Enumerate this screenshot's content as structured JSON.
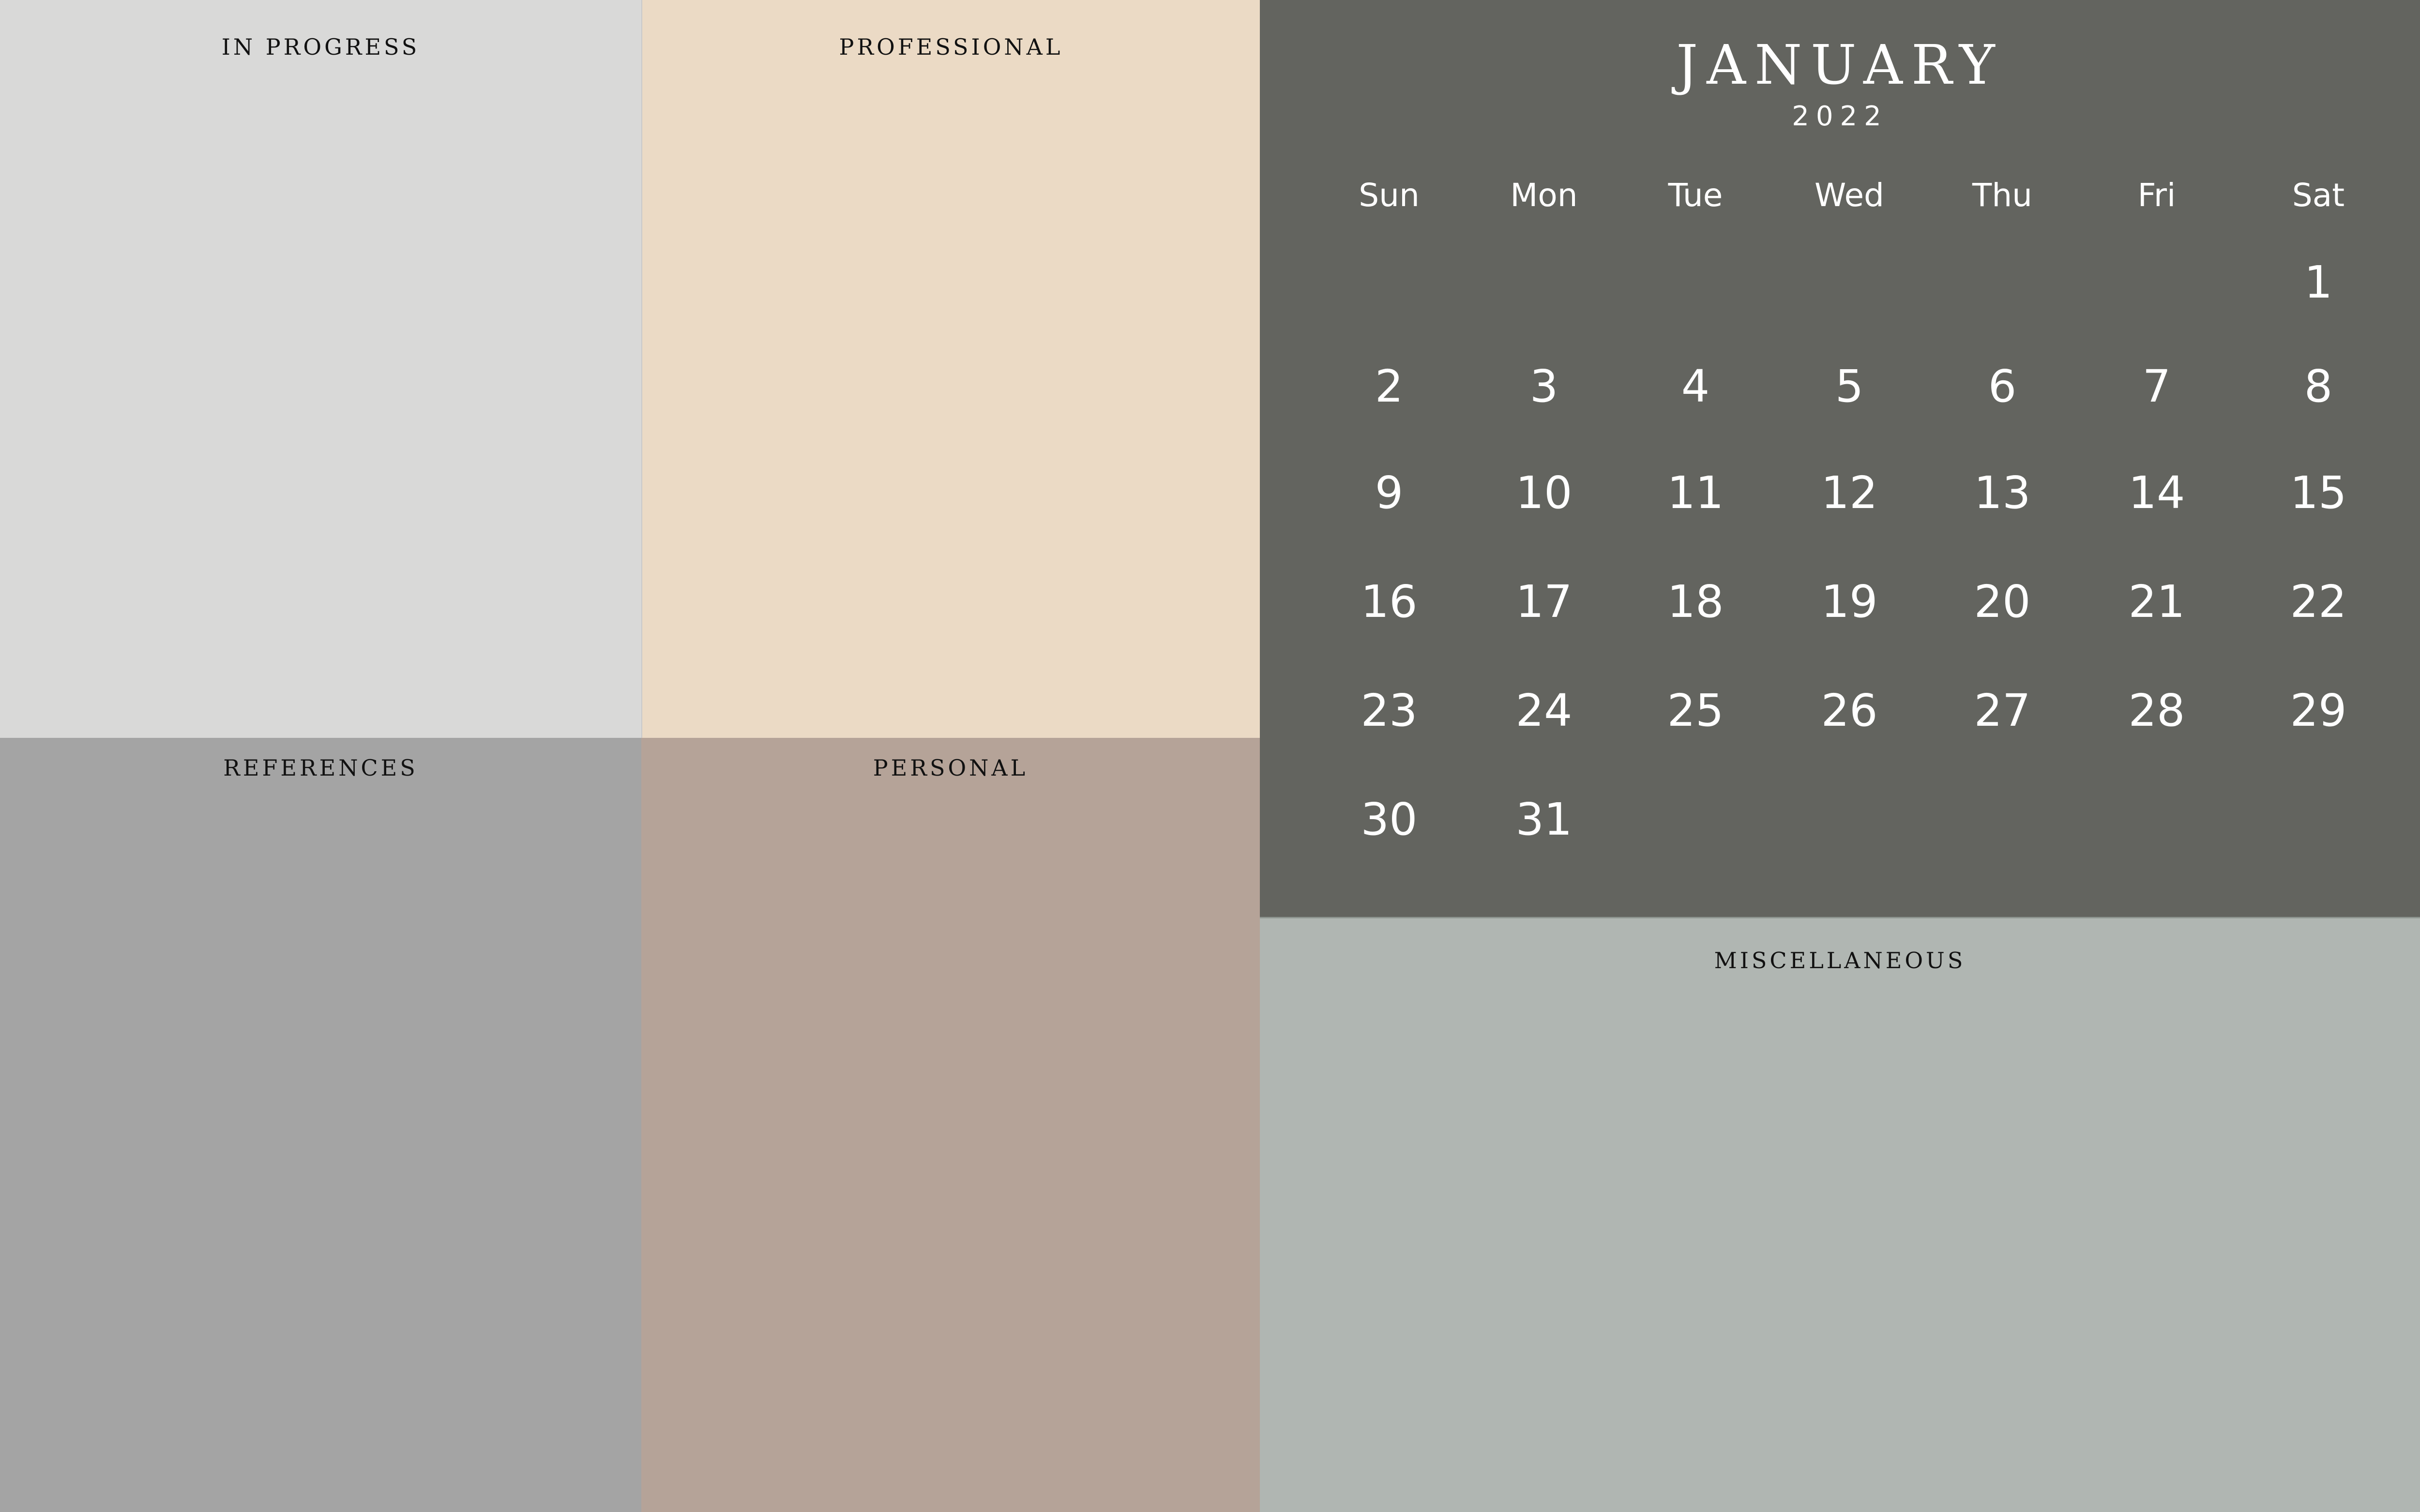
{
  "panels": {
    "in_progress": {
      "label": "IN PROGRESS",
      "color": "#d9d9d8"
    },
    "professional": {
      "label": "PROFESSIONAL",
      "color": "#ebdac5"
    },
    "references": {
      "label": "REFERENCES",
      "color": "#a4a4a4"
    },
    "personal": {
      "label": "PERSONAL",
      "color": "#b5a398"
    },
    "miscellaneous": {
      "label": "MISCELLANEOUS",
      "color": "#b0b6b2"
    }
  },
  "calendar": {
    "month": "JANUARY",
    "year": "2022",
    "color": "#63645f",
    "weekdays": [
      "Sun",
      "Mon",
      "Tue",
      "Wed",
      "Thu",
      "Fri",
      "Sat"
    ],
    "weeks": [
      [
        "",
        "",
        "",
        "",
        "",
        "",
        "1"
      ],
      [
        "2",
        "3",
        "4",
        "5",
        "6",
        "7",
        "8"
      ],
      [
        "9",
        "10",
        "11",
        "12",
        "13",
        "14",
        "15"
      ],
      [
        "16",
        "17",
        "18",
        "19",
        "20",
        "21",
        "22"
      ],
      [
        "23",
        "24",
        "25",
        "26",
        "27",
        "28",
        "29"
      ],
      [
        "30",
        "31",
        "",
        "",
        "",
        "",
        ""
      ]
    ]
  }
}
